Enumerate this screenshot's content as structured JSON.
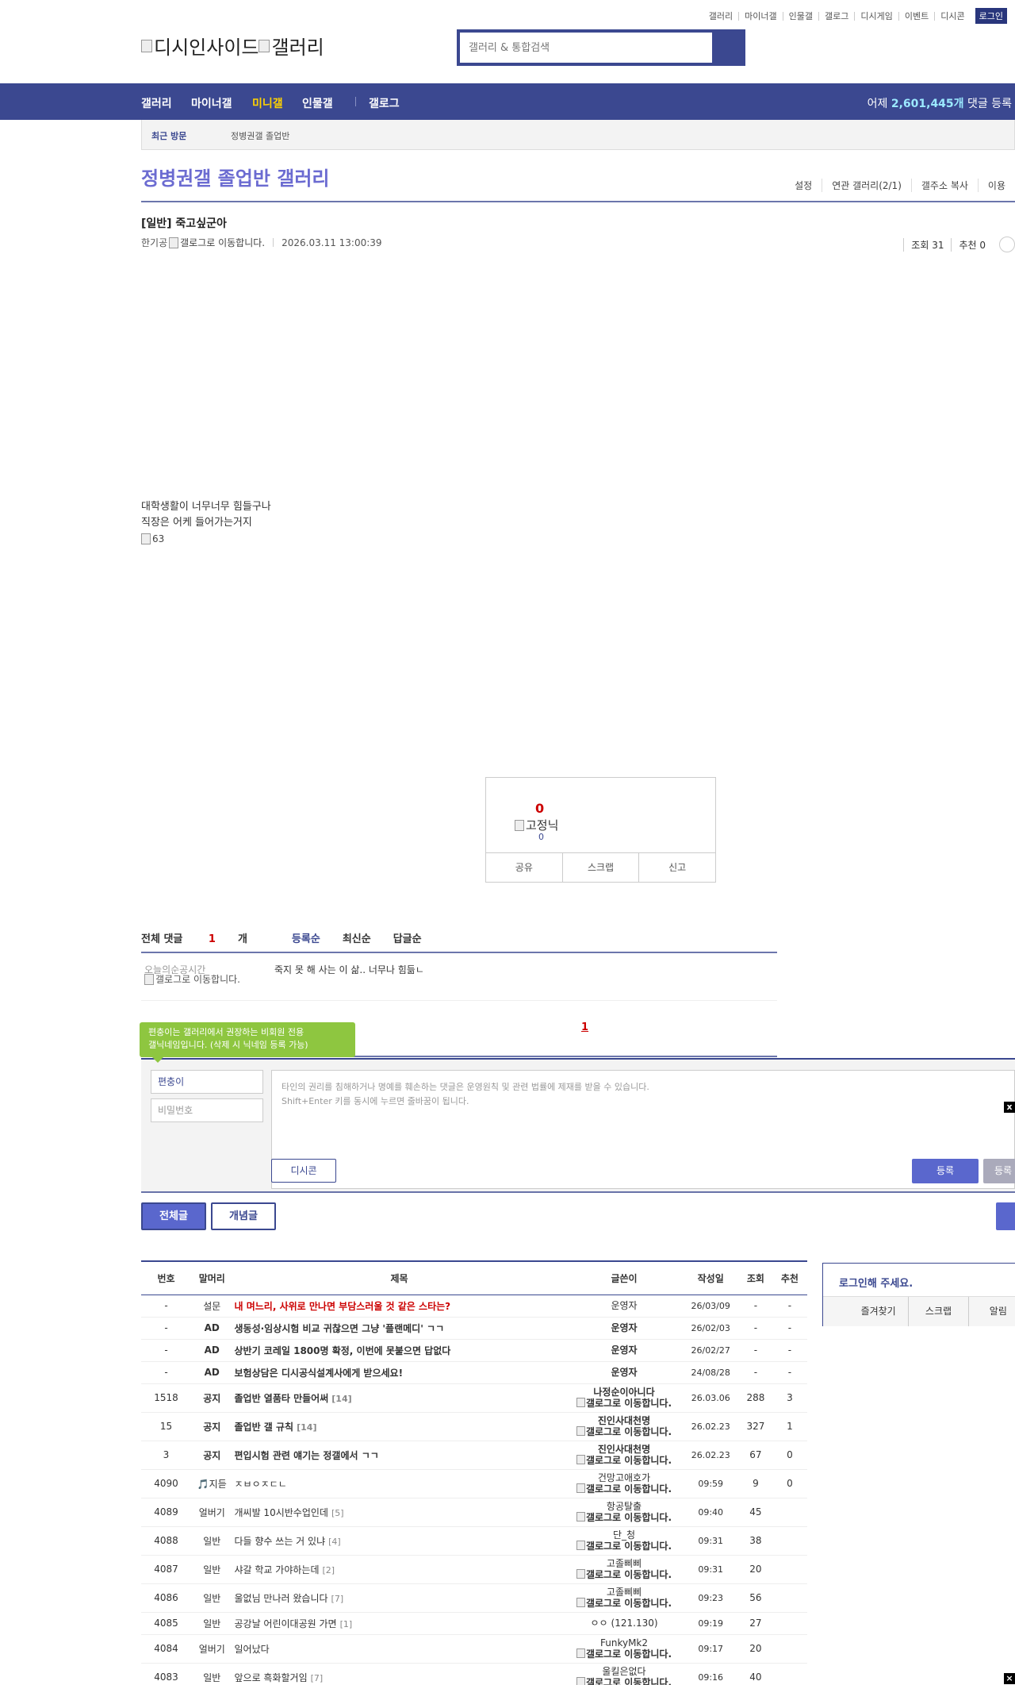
{
  "top_links": [
    "갤러리",
    "마이너갤",
    "인물갤",
    "갤로그",
    "디시게임",
    "이벤트",
    "디시콘"
  ],
  "login_label": "로그인",
  "logo": {
    "left": "디시인사이드",
    "right": "갤러리"
  },
  "search": {
    "placeholder": "갤러리 & 통합검색"
  },
  "nav": {
    "items": [
      "갤러리",
      "마이너갤",
      "미니갤",
      "인물갤",
      "갤로그"
    ],
    "right_prefix": "어제",
    "right_count": "2,601,445개",
    "right_suffix": "댓글 등록"
  },
  "recent": {
    "label": "최근 방문",
    "value": "정병권갤 졸업반"
  },
  "gallery": {
    "title": "정병권갤 졸업반 갤러리",
    "links": [
      "설정",
      "연관 갤러리(2/1)",
      "갤주소 복사",
      "이용"
    ]
  },
  "post": {
    "title": "[일반] 죽고싶군아",
    "author": "한기공",
    "author_img_alt": "갤로그로 이동합니다.",
    "date": "2026.03.11 13:00:39",
    "views": "조회 31",
    "recommend": "추천 0",
    "body_lines": [
      "대학생활이 너무너무 힘들구나",
      "직장은 어케 들어가는거지"
    ],
    "body_img_alt": "63"
  },
  "vote": {
    "count": "0",
    "fixed_nick_alt": "고정닉",
    "fixed_count": "0",
    "actions": [
      "공유",
      "스크랩",
      "신고"
    ]
  },
  "comments": {
    "total_label": "전체 댓글",
    "total_count": "1",
    "total_unit": "개",
    "sorts": [
      "등록순",
      "최신순",
      "답글순"
    ],
    "items": [
      {
        "nick": "오늘의순공시간",
        "nick_img_alt": "갤로그로 이동합니다.",
        "text": "죽지 못 해 사는 이 삶.. 너무나 힘듦ㄴ"
      }
    ],
    "page": "1"
  },
  "write": {
    "tooltip_line1": "편충이는 갤러리에서 권장하는 비회원 전용",
    "tooltip_line2": "갤닉네임입니다. (삭제 시 닉네임 등록 가능)",
    "nick_value": "편충이",
    "pw_placeholder": "비밀번호",
    "textarea_line1": "타인의 권리를 침해하거나 명예를 훼손하는 댓글은 운영원칙 및 관련 법률에 제재를 받을 수 있습니다.",
    "textarea_line2": "Shift+Enter 키를 동시에 누르면 줄바꿈이 됩니다.",
    "dccon_label": "디시콘",
    "submit_label": "등록",
    "submit2_label": "등록",
    "close_label": "x"
  },
  "list_tabs": [
    "전체글",
    "개념글"
  ],
  "table": {
    "headers": [
      "번호",
      "말머리",
      "제목",
      "글쓴이",
      "작성일",
      "조회",
      "추천"
    ],
    "rows": [
      {
        "no": "-",
        "head": "설문",
        "title": "내 며느리, 사위로 만나면 부담스러울 것 같은 스타는?",
        "cnt": "",
        "writer": "운영자",
        "writer_sub": "",
        "date": "26/03/09",
        "views": "-",
        "rec": "-",
        "kind": "survey"
      },
      {
        "no": "-",
        "head": "AD",
        "title": "생동성·임상시험 비교 귀찮으면 그냥 '플랜메디' ㄱㄱ",
        "cnt": "",
        "writer": "운영자",
        "writer_sub": "",
        "date": "26/02/03",
        "views": "-",
        "rec": "-",
        "kind": "bold"
      },
      {
        "no": "-",
        "head": "AD",
        "title": "상반기 코레일 1800명 확정, 이번에 못붙으면 답없다",
        "cnt": "",
        "writer": "운영자",
        "writer_sub": "",
        "date": "26/02/27",
        "views": "-",
        "rec": "-",
        "kind": "bold"
      },
      {
        "no": "-",
        "head": "AD",
        "title": "보험상담은 디시공식설계사에게 받으세요!",
        "cnt": "",
        "writer": "운영자",
        "writer_sub": "",
        "date": "24/08/28",
        "views": "-",
        "rec": "-",
        "kind": "bold"
      },
      {
        "no": "1518",
        "head": "공지",
        "title": "졸업반 열품타 만들어써",
        "cnt": "[14]",
        "writer": "나정순이아니다",
        "writer_sub": "갤로그로 이동합니다.",
        "date": "26.03.06",
        "views": "288",
        "rec": "3",
        "kind": "bold"
      },
      {
        "no": "15",
        "head": "공지",
        "title": "졸업반 갤 규칙",
        "cnt": "[14]",
        "writer": "진인사대천명",
        "writer_sub": "갤로그로 이동합니다.",
        "date": "26.02.23",
        "views": "327",
        "rec": "1",
        "kind": "bold"
      },
      {
        "no": "3",
        "head": "공지",
        "title": "편입시험 관련 얘기는 정갤에서 ㄱㄱ",
        "cnt": "",
        "writer": "진인사대천명",
        "writer_sub": "갤로그로 이동합니다.",
        "date": "26.02.23",
        "views": "67",
        "rec": "0",
        "kind": "bold"
      },
      {
        "no": "4090",
        "head": "🎵지듣",
        "title": "ㅈㅂㅇㅈㄷㄴ",
        "cnt": "",
        "writer": "건망고애호가",
        "writer_sub": "갤로그로 이동합니다.",
        "date": "09:59",
        "views": "9",
        "rec": "0",
        "kind": "normal"
      },
      {
        "no": "4089",
        "head": "얼버기",
        "title": "개씨발 10시반수업인데",
        "cnt": "[5]",
        "writer": "항공탈출",
        "writer_sub": "갤로그로 이동합니다.",
        "date": "09:40",
        "views": "45",
        "rec": "",
        "kind": "normal"
      },
      {
        "no": "4088",
        "head": "일반",
        "title": "다들 향수 쓰는 거 있냐",
        "cnt": "[4]",
        "writer": "단_청",
        "writer_sub": "갤로그로 이동합니다.",
        "date": "09:31",
        "views": "38",
        "rec": "",
        "kind": "normal"
      },
      {
        "no": "4087",
        "head": "일반",
        "title": "샤갈 학교 가야하는데",
        "cnt": "[2]",
        "writer": "고졸삐삐",
        "writer_sub": "갤로그로 이동합니다.",
        "date": "09:31",
        "views": "20",
        "rec": "",
        "kind": "normal"
      },
      {
        "no": "4086",
        "head": "일반",
        "title": "울없님 만나러 왔습니다",
        "cnt": "[7]",
        "writer": "고졸삐삐",
        "writer_sub": "갤로그로 이동합니다.",
        "date": "09:23",
        "views": "56",
        "rec": "",
        "kind": "normal"
      },
      {
        "no": "4085",
        "head": "일반",
        "title": "공강날 어린이대공원 가면",
        "cnt": "[1]",
        "writer": "ㅇㅇ",
        "writer_sub": "",
        "writer_ip": "(121.130)",
        "date": "09:19",
        "views": "27",
        "rec": "",
        "kind": "normal"
      },
      {
        "no": "4084",
        "head": "얼버기",
        "title": "일어났다",
        "cnt": "",
        "writer": "FunkyMk2",
        "writer_sub": "갤로그로 이동합니다.",
        "date": "09:17",
        "views": "20",
        "rec": "",
        "kind": "normal"
      },
      {
        "no": "4083",
        "head": "일반",
        "title": "앞으로 흑화할거임",
        "cnt": "[7]",
        "writer": "울킬은없다",
        "writer_sub": "갤로그로 이동합니다.",
        "date": "09:16",
        "views": "40",
        "rec": "",
        "kind": "normal"
      }
    ]
  },
  "login_panel": {
    "title": "로그인해 주세요.",
    "links": [
      "즐겨찾기",
      "스크랩",
      "알림"
    ]
  }
}
